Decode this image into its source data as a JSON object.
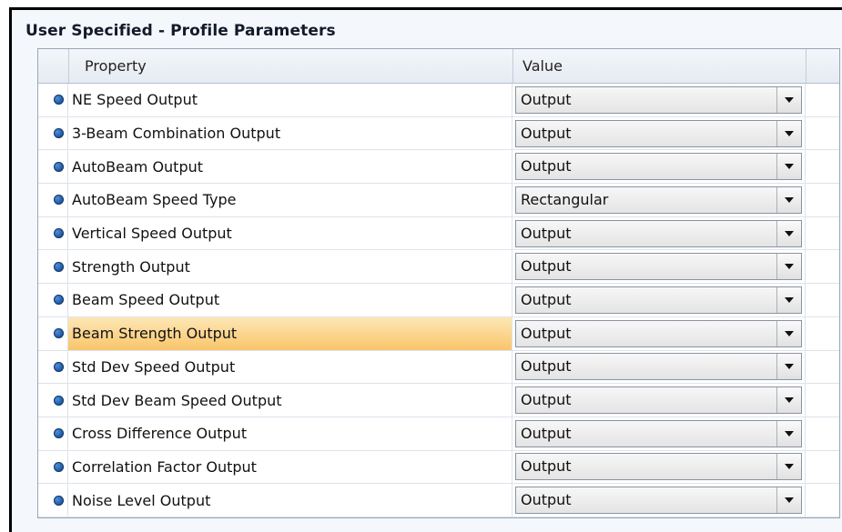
{
  "panel": {
    "title": "User Specified - Profile Parameters"
  },
  "grid": {
    "columns": {
      "property": "Property",
      "value": "Value"
    },
    "rows": [
      {
        "property": "NE Speed Output",
        "value": "Output",
        "selected": false
      },
      {
        "property": "3-Beam Combination Output",
        "value": "Output",
        "selected": false
      },
      {
        "property": "AutoBeam Output",
        "value": "Output",
        "selected": false
      },
      {
        "property": "AutoBeam Speed Type",
        "value": "Rectangular",
        "selected": false
      },
      {
        "property": "Vertical Speed Output",
        "value": "Output",
        "selected": false
      },
      {
        "property": "Strength Output",
        "value": "Output",
        "selected": false
      },
      {
        "property": "Beam Speed Output",
        "value": "Output",
        "selected": false
      },
      {
        "property": "Beam Strength Output",
        "value": "Output",
        "selected": true
      },
      {
        "property": "Std Dev Speed Output",
        "value": "Output",
        "selected": false
      },
      {
        "property": "Std Dev Beam Speed Output",
        "value": "Output",
        "selected": false
      },
      {
        "property": "Cross Difference Output",
        "value": "Output",
        "selected": false
      },
      {
        "property": "Correlation Factor Output",
        "value": "Output",
        "selected": false
      },
      {
        "property": "Noise Level Output",
        "value": "Output",
        "selected": false
      }
    ]
  },
  "icons": {
    "row_marker": "bullet-icon",
    "dropdown": "chevron-down-icon"
  },
  "colors": {
    "selected_row": "#f9c56a",
    "row_marker": "#1a4f94"
  }
}
